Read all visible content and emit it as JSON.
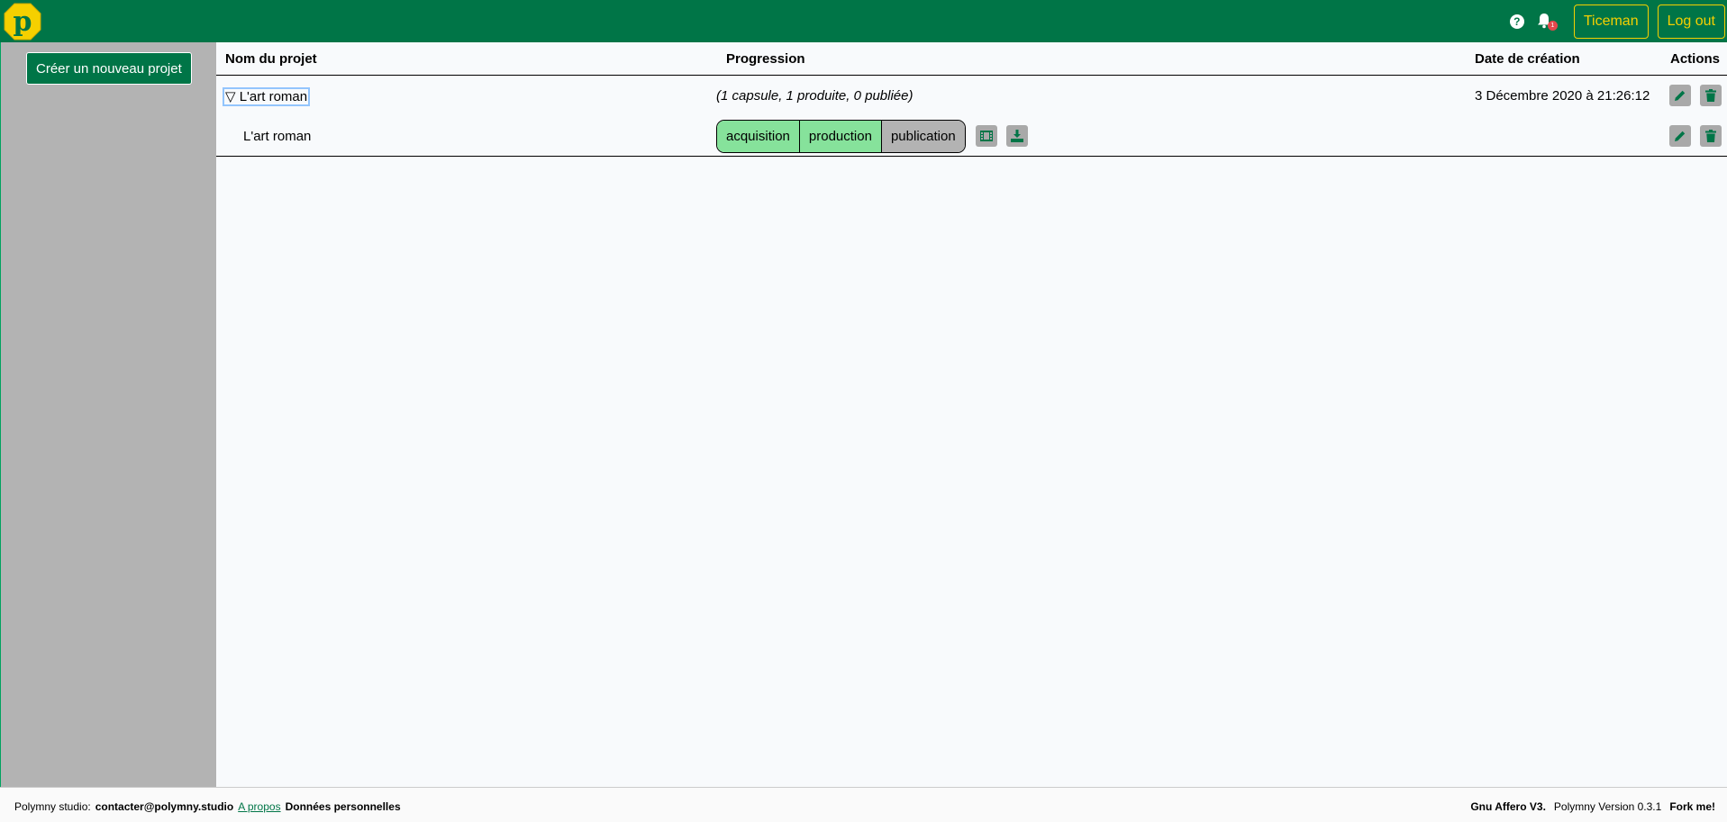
{
  "header": {
    "logo_letter": "p",
    "notification_count": "1",
    "user_label": "Ticeman",
    "logout_label": "Log out"
  },
  "sidebar": {
    "new_project_label": "Créer un nouveau projet"
  },
  "table": {
    "columns": {
      "name": "Nom du projet",
      "progress": "Progression",
      "date": "Date de création",
      "actions": "Actions"
    },
    "project": {
      "name": "▽ L'art roman",
      "summary": "(1 capsule, 1 produite, 0 publiée)",
      "date": "3 Décembre 2020 à 21:26:12"
    },
    "capsule": {
      "name": "L'art roman",
      "stages": [
        "acquisition",
        "production",
        "publication"
      ]
    }
  },
  "footer": {
    "brand": "Polymny studio:",
    "email": "contacter@polymny.studio",
    "about": "A propos",
    "privacy": "Données personnelles",
    "license": "Gnu Affero V3.",
    "version": "Polymny Version 0.3.1",
    "fork": "Fork me!"
  },
  "colors": {
    "brand_green": "#007547",
    "accent_yellow": "#f5d000",
    "stage_done": "#86e29b",
    "stage_todo": "#b3b3b3"
  }
}
